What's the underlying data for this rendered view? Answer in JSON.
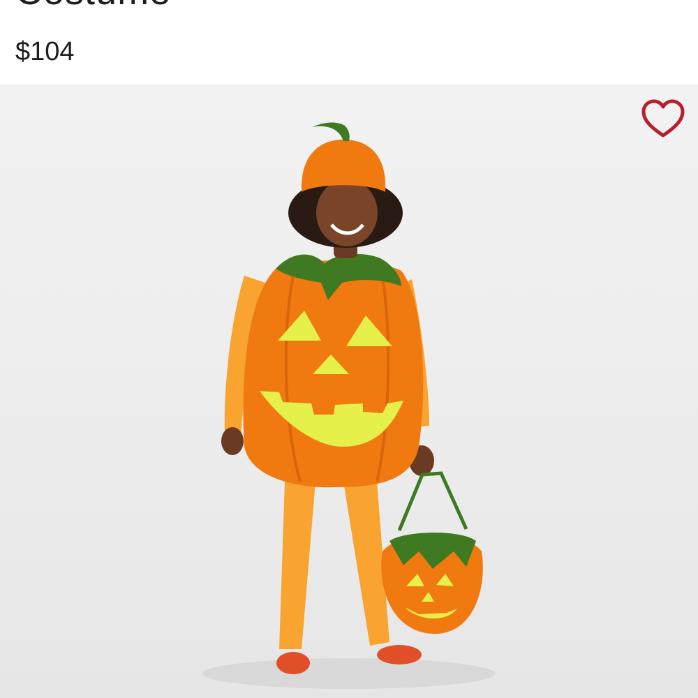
{
  "product": {
    "title": "Costume",
    "price": "$104"
  },
  "icons": {
    "favorite": "heart-outline-icon"
  },
  "colors": {
    "favorite_stroke": "#b5202e",
    "pumpkin": "#f07a10",
    "face": "#e6f04a",
    "leaf": "#3f7a22"
  }
}
